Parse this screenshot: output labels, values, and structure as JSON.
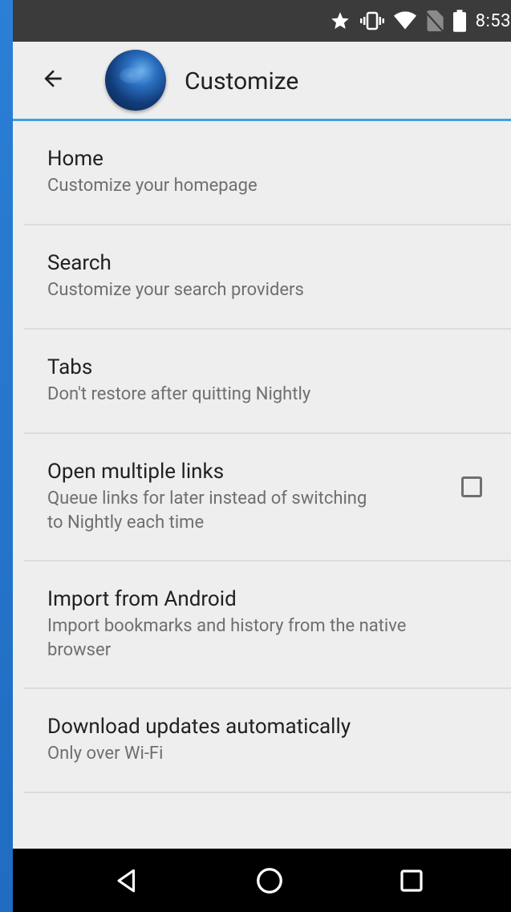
{
  "status_bar": {
    "time": "8:53",
    "icons": [
      "star-icon",
      "vibrate-icon",
      "wifi-icon",
      "no-sim-icon",
      "battery-icon"
    ]
  },
  "toolbar": {
    "title": "Customize",
    "back_icon": "back-arrow-icon",
    "logo": "nightly-globe-logo"
  },
  "settings": [
    {
      "title": "Home",
      "subtitle": "Customize your homepage"
    },
    {
      "title": "Search",
      "subtitle": "Customize your search providers"
    },
    {
      "title": "Tabs",
      "subtitle": "Don't restore after quitting Nightly"
    },
    {
      "title": "Open multiple links",
      "subtitle_line1": "Queue links for later instead of switching",
      "subtitle_line2": "to Nightly each time",
      "checkbox_checked": false
    },
    {
      "title": "Import from Android",
      "subtitle_line1": "Import bookmarks and history from the native",
      "subtitle_line2": "browser"
    },
    {
      "title": "Download updates automatically",
      "subtitle": "Only over Wi-Fi"
    }
  ],
  "nav_bar": {
    "icons": [
      "back-triangle-icon",
      "home-circle-icon",
      "recents-square-icon"
    ]
  },
  "colors": {
    "accent": "#3aa3e3",
    "background": "#eeeeee",
    "status_bar": "#3b3b3b",
    "nav_bar": "#000000",
    "frame": "#2a7bd0"
  }
}
